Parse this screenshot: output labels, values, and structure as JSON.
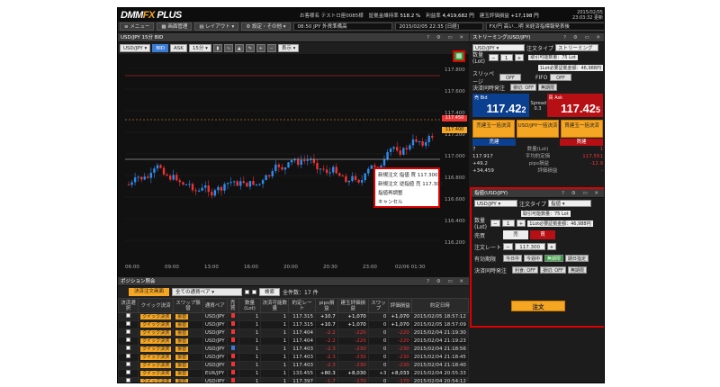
{
  "app": {
    "logo_main": "DMM",
    "logo_accent": "FX",
    "logo_suffix": " PLUS",
    "stats": [
      {
        "label": "お客様名 テストロ座0085様"
      },
      {
        "label": "証拠金維持率",
        "value": "518.2 %"
      },
      {
        "label": "利益率",
        "value": "4,419,682 円"
      },
      {
        "label": "建玉評価損益",
        "value": "+17,198 円"
      }
    ],
    "date": "2015/02/05",
    "time": "23:03:32 更新"
  },
  "menubar": {
    "menu": "メニュー",
    "screen": "画面管理",
    "layout": "レイアウト",
    "settings": "設定・その他",
    "ticker1": "08:50 JPY 外貨準備高",
    "ticker2": "2015/02/05 22:35 [日経]",
    "ticker3": "FX/円 高い…明 米経済指標報発表後"
  },
  "chart": {
    "title": "USD/JPY 15分 BID",
    "pair": "USD/JPY",
    "bid_label": "BID",
    "ask_label": "ASK",
    "interval": "15分",
    "display": "表示",
    "yticks": [
      "117.800",
      "117.600",
      "117.400",
      "117.200",
      "117.000",
      "116.800",
      "116.600",
      "116.400",
      "116.200"
    ],
    "xticks": [
      "06:00",
      "09:00",
      "13:00",
      "16:00",
      "20:00",
      "20:30",
      "23:00",
      "02/06 01:30"
    ],
    "ask_tag": "117.450",
    "bid_tag": "117.400",
    "context_menu": [
      "新規注文 指値 買 117.300",
      "新規注文 逆指値 売 117.300",
      "指値再調整",
      "キャンセル"
    ],
    "icon_grid": "grid-icon"
  },
  "positions": {
    "title": "ポジション照会",
    "settle_button": "決済注文画面",
    "filter": "全ての通貨ペア",
    "search": "検索",
    "count_label": "全件数：",
    "count": "17 件",
    "columns": [
      "決済選択",
      "クイック決済",
      "スワップ振替",
      "通貨ペア",
      "売買",
      "数量(Lot)",
      "決済可能数量",
      "約定レート",
      "pips損益",
      "建玉評価損益",
      "スワップ",
      "評価損益",
      "約定日時"
    ],
    "rows": [
      {
        "pair": "USD/JPY",
        "side": "buy",
        "qty": "1",
        "avail": "1",
        "rate": "117.315",
        "pips": "+10.7",
        "pl": "+1,070",
        "swap": "0",
        "total": "+1,070",
        "date": "2015/02/05 18:57:12"
      },
      {
        "pair": "USD/JPY",
        "side": "buy",
        "qty": "1",
        "avail": "1",
        "rate": "117.315",
        "pips": "+10.7",
        "pl": "+1,070",
        "swap": "0",
        "total": "+1,070",
        "date": "2015/02/05 18:57:09"
      },
      {
        "pair": "USD/JPY",
        "side": "buy",
        "qty": "1",
        "avail": "1",
        "rate": "117.404",
        "pips": "-2.2",
        "pl": "-220",
        "swap": "0",
        "total": "-220",
        "date": "2015/02/04 21:19:30"
      },
      {
        "pair": "USD/JPY",
        "side": "buy",
        "qty": "1",
        "avail": "1",
        "rate": "117.404",
        "pips": "-2.2",
        "pl": "-220",
        "swap": "0",
        "total": "-220",
        "date": "2015/02/04 21:19:23"
      },
      {
        "pair": "USD/JPY",
        "side": "sell",
        "qty": "1",
        "avail": "1",
        "rate": "117.403",
        "pips": "-2.3",
        "pl": "-230",
        "swap": "0",
        "total": "-230",
        "date": "2015/02/04 21:18:56"
      },
      {
        "pair": "USD/JPY",
        "side": "buy",
        "qty": "1",
        "avail": "1",
        "rate": "117.403",
        "pips": "-2.3",
        "pl": "-230",
        "swap": "0",
        "total": "-230",
        "date": "2015/02/04 21:18:45"
      },
      {
        "pair": "USD/JPY",
        "side": "buy",
        "qty": "1",
        "avail": "1",
        "rate": "117.403",
        "pips": "-2.3",
        "pl": "-230",
        "swap": "0",
        "total": "-230",
        "date": "2015/02/04 21:18:40"
      },
      {
        "pair": "EUR/JPY",
        "side": "buy",
        "qty": "1",
        "avail": "1",
        "rate": "133.455",
        "pips": "+80.3",
        "pl": "+8,030",
        "swap": "+3",
        "total": "+8,033",
        "date": "2015/02/04 20:55:33"
      },
      {
        "pair": "USD/JPY",
        "side": "buy",
        "qty": "1",
        "avail": "1",
        "rate": "117.397",
        "pips": "-1.7",
        "pl": "-170",
        "swap": "0",
        "total": "-170",
        "date": "2015/02/04 20:54:12"
      }
    ],
    "quick_label": "クイック決済",
    "swap_label": "振替"
  },
  "streaming": {
    "title": "ストリーミング(USD/JPY)",
    "pair": "USD/JPY",
    "order_type_label": "注文タイプ",
    "order_type": "ストリーミング",
    "qty_label": "数量(Lot)",
    "qty": "1",
    "avail": "取引可能数量：75 Lot",
    "margin": "1Lot必要証拠金額：46,988円",
    "slippage_label": "スリッページ",
    "slippage": "OFF",
    "fifo_label": "FIFO",
    "fifo": "OFF",
    "settle_label": "決済同時発注",
    "settle_off": "損切: OFF",
    "settle_none": "無期限",
    "bid_label": "売",
    "bid_sub": "Bid",
    "bid_price": "117.42",
    "bid_pip": "2",
    "spread": "0.3",
    "spread_label": "Spread",
    "ask_label": "買",
    "ask_sub": "Ask",
    "ask_price": "117.42",
    "ask_pip": "5",
    "btn_sell_settle": "売建玉一括決済",
    "btn_all_settle": "USD/JPY一括決済",
    "btn_buy_settle": "買建玉一括決済",
    "sell_tab": "売建",
    "buy_tab": "買建",
    "summary": [
      {
        "l": "7",
        "m": "数量(Lot)",
        "r": "1"
      },
      {
        "l": "117.917",
        "m": "平均約定価",
        "r": "117.551"
      },
      {
        "l": "+49.2",
        "m": "pips損益",
        "r": "-12.9"
      },
      {
        "l": "+34,459",
        "m": "評価損益",
        "r": "-"
      }
    ]
  },
  "orderpanel": {
    "title": "指値(USD/JPY)",
    "pair": "USD/JPY",
    "order_type_label": "注文タイプ",
    "order_type": "指値",
    "qty_label": "数量(Lot)",
    "qty": "1",
    "avail": "取引可能数量：75 Lot",
    "margin": "1Lot必要証拠金額：46,988円",
    "side_label": "売買",
    "sell": "売",
    "buy": "買",
    "rate_label": "注文レート",
    "rate": "117.300",
    "expiry_label": "有効期限",
    "expiry": [
      "今日中",
      "今週中",
      "無期限",
      "期日指定"
    ],
    "settle_label": "決済同時発注",
    "settle1": "利食: OFF",
    "settle2": "損切: OFF",
    "settle3": "無期限",
    "submit": "注文"
  }
}
